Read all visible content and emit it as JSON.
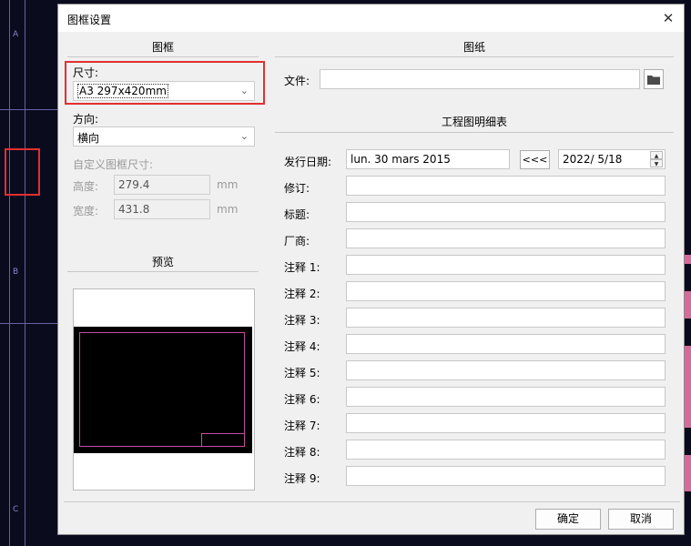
{
  "window": {
    "title": "图框设置",
    "close_glyph": "✕"
  },
  "frame": {
    "header": "图框",
    "size_label": "尺寸:",
    "size_value": "A3 297x420mm",
    "orientation_label": "方向:",
    "orientation_value": "横向",
    "custom_label": "自定义图框尺寸:",
    "height_label": "高度:",
    "height_value": "279.4",
    "height_unit": "mm",
    "width_label": "宽度:",
    "width_value": "431.8",
    "width_unit": "mm",
    "preview_header": "预览"
  },
  "drawing": {
    "header": "图纸",
    "file_label": "文件:",
    "file_value": "",
    "folder_icon": "folder-icon",
    "details_header": "工程图明细表",
    "issue_date_label": "发行日期:",
    "issue_date_value": "lun. 30 mars 2015",
    "date_copy_button": "<<<",
    "date_picker_value": "2022/  5/18",
    "fields": [
      {
        "label": "修订:",
        "value": ""
      },
      {
        "label": "标题:",
        "value": ""
      },
      {
        "label": "厂商:",
        "value": ""
      },
      {
        "label": "注释 1:",
        "value": ""
      },
      {
        "label": "注释 2:",
        "value": ""
      },
      {
        "label": "注释 3:",
        "value": ""
      },
      {
        "label": "注释 4:",
        "value": ""
      },
      {
        "label": "注释 5:",
        "value": ""
      },
      {
        "label": "注释 6:",
        "value": ""
      },
      {
        "label": "注释 7:",
        "value": ""
      },
      {
        "label": "注释 8:",
        "value": ""
      },
      {
        "label": "注释 9:",
        "value": ""
      }
    ]
  },
  "footer": {
    "ok": "确定",
    "cancel": "取消"
  },
  "background": {
    "ruler_labels": [
      "A",
      "B",
      "C"
    ]
  },
  "colors": {
    "highlight_border": "#e03030",
    "preview_frame": "#c050a0",
    "background": "#0b0b1e"
  }
}
